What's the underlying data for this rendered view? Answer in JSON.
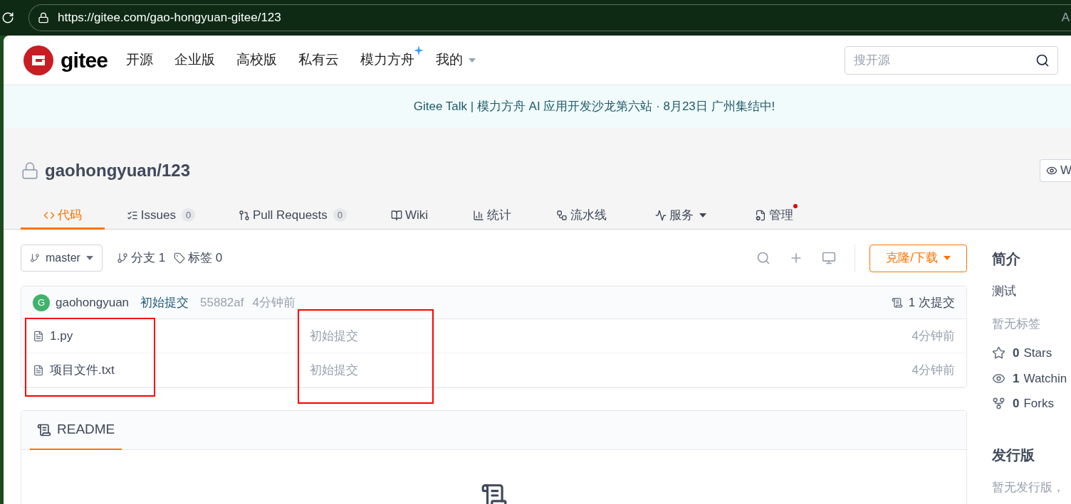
{
  "browser": {
    "url": "https://gitee.com/gao-hongyuan-gitee/123",
    "edge_text": "A"
  },
  "nav": {
    "logo": "gitee",
    "items": [
      {
        "label": "开源",
        "sparkle": false,
        "dropdown": false
      },
      {
        "label": "企业版",
        "sparkle": false,
        "dropdown": false
      },
      {
        "label": "高校版",
        "sparkle": false,
        "dropdown": false
      },
      {
        "label": "私有云",
        "sparkle": false,
        "dropdown": false
      },
      {
        "label": "模力方舟",
        "sparkle": true,
        "dropdown": false
      },
      {
        "label": "我的",
        "sparkle": false,
        "dropdown": true
      }
    ],
    "search": {
      "placeholder": "搜开源"
    }
  },
  "banner": "Gitee Talk | 模力方舟 AI 应用开发沙龙第六站 · 8月23日 广州集结中!",
  "repo": {
    "name": "gaohongyuan/123",
    "private": true,
    "watch_button": "W"
  },
  "tabs": [
    {
      "label": "代码",
      "selected": true
    },
    {
      "label": "Issues",
      "count": "0",
      "selected": false
    },
    {
      "label": "Pull Requests",
      "count": "0",
      "selected": false
    },
    {
      "label": "Wiki",
      "selected": false
    },
    {
      "label": "统计",
      "selected": false
    },
    {
      "label": "流水线",
      "selected": false
    },
    {
      "label": "服务",
      "dropdown": true,
      "selected": false
    },
    {
      "label": "管理",
      "dot": true,
      "selected": false
    }
  ],
  "toolbar": {
    "branch": "master",
    "branches": "分支 1",
    "tags": "标签 0",
    "clone": "克隆/下载"
  },
  "commit": {
    "avatar": "G",
    "author": "gaohongyuan",
    "message": "初始提交",
    "hash": "55882af",
    "time": "4分钟前",
    "count": "1 次提交"
  },
  "files": [
    {
      "name": "1.py",
      "message": "初始提交",
      "time": "4分钟前"
    },
    {
      "name": "项目文件.txt",
      "message": "初始提交",
      "time": "4分钟前"
    }
  ],
  "readme": {
    "tab": "README",
    "selected": true
  },
  "sidebar": {
    "intro_title": "简介",
    "description": "测试",
    "tags_empty": "暂无标签",
    "stats": [
      {
        "count": "0",
        "label": "Stars"
      },
      {
        "count": "1",
        "label": "Watchin"
      },
      {
        "count": "0",
        "label": "Forks"
      }
    ],
    "releases_title": "发行版",
    "releases_empty": "暂无发行版，"
  },
  "markups": [
    {
      "color": "#ff0000"
    },
    {
      "color": "#ff0000"
    }
  ]
}
